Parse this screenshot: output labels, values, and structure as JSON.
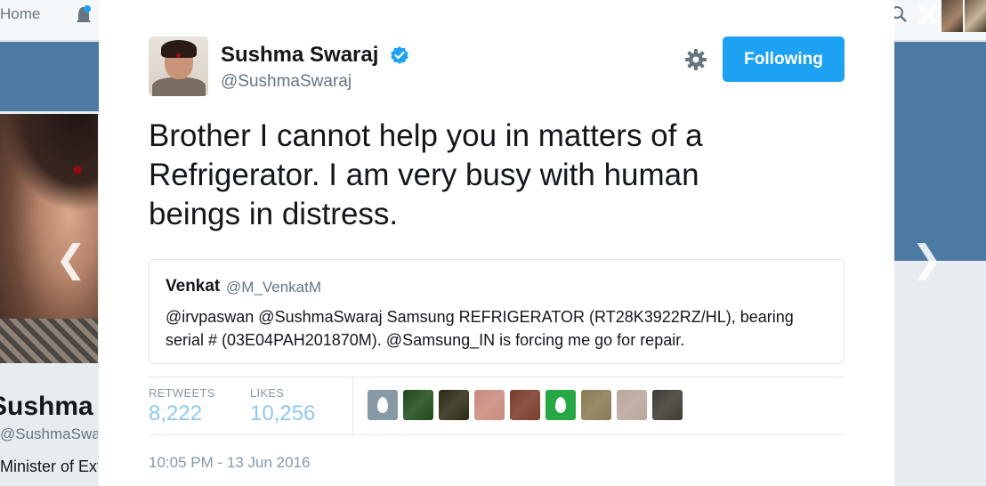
{
  "background": {
    "nav_home": "Home",
    "profile_name": "Sushma Swaraj",
    "profile_handle": "@SushmaSwaraj",
    "profile_bio": "Minister of External Affairs"
  },
  "modal": {
    "close_icon": "close-icon",
    "prev_icon": "chevron-left-icon",
    "next_icon": "chevron-right-icon",
    "tweet": {
      "author_name": "Sushma Swaraj",
      "author_handle": "@SushmaSwaraj",
      "verified": true,
      "follow_label": "Following",
      "text": "Brother I cannot help you in matters of a Refrigerator. I am very busy with human beings in distress.",
      "quoted": {
        "name": "Venkat",
        "handle": "@M_VenkatM",
        "text": "@irvpaswan @SushmaSwaraj Samsung REFRIGERATOR (RT28K3922RZ/HL), bearing serial # (03E04PAH201870M). @Samsung_IN is forcing me go for repair."
      },
      "stats": {
        "retweets_label": "RETWEETS",
        "retweets_value": "8,222",
        "likes_label": "LIKES",
        "likes_value": "10,256"
      },
      "timestamp": "10:05 PM - 13 Jun 2016"
    }
  },
  "colors": {
    "accent": "#1da1f2",
    "stat_value": "#8ec8ee",
    "banner": "#4c7aa3",
    "muted_text": "#66757f"
  },
  "likers": [
    {
      "kind": "egg",
      "color": "#8899a6"
    },
    {
      "kind": "photo",
      "color": "#1f4a1a"
    },
    {
      "kind": "photo",
      "color": "#2d2a14"
    },
    {
      "kind": "photo",
      "color": "#c98a7d"
    },
    {
      "kind": "photo",
      "color": "#7a3b2a"
    },
    {
      "kind": "egg",
      "color": "#28a745"
    },
    {
      "kind": "photo",
      "color": "#8a7a52"
    },
    {
      "kind": "photo",
      "color": "#b9a79b"
    },
    {
      "kind": "photo",
      "color": "#3d3a32"
    }
  ]
}
